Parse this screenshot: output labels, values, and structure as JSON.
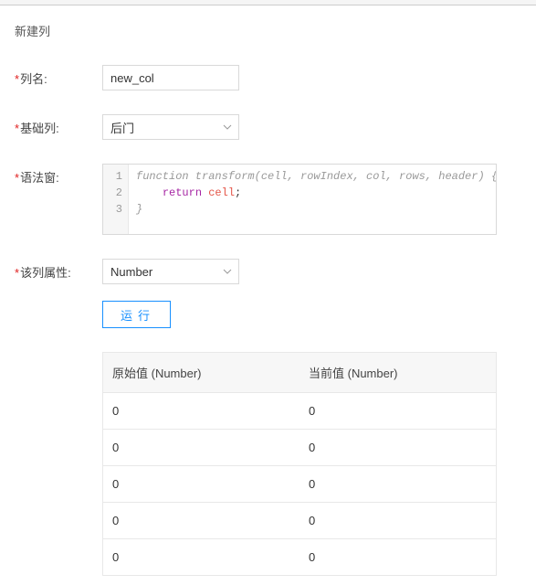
{
  "title": "新建列",
  "labels": {
    "col_name": "列名:",
    "base_col": "基础列:",
    "syntax": "语法窗:",
    "col_attr": "该列属性:"
  },
  "fields": {
    "col_name_value": "new_col",
    "base_col_value": "后门",
    "col_attr_value": "Number"
  },
  "code": {
    "line1": "function transform(cell, rowIndex, col, rows, header) {",
    "line2_kw": "return",
    "line2_id": "cell",
    "line3": "}",
    "gutter1": "1",
    "gutter2": "2",
    "gutter3": "3"
  },
  "buttons": {
    "run": "运行"
  },
  "table": {
    "header_orig": "原始值 (Number)",
    "header_curr": "当前值 (Number)",
    "rows": [
      {
        "orig": "0",
        "curr": "0"
      },
      {
        "orig": "0",
        "curr": "0"
      },
      {
        "orig": "0",
        "curr": "0"
      },
      {
        "orig": "0",
        "curr": "0"
      },
      {
        "orig": "0",
        "curr": "0"
      }
    ]
  }
}
